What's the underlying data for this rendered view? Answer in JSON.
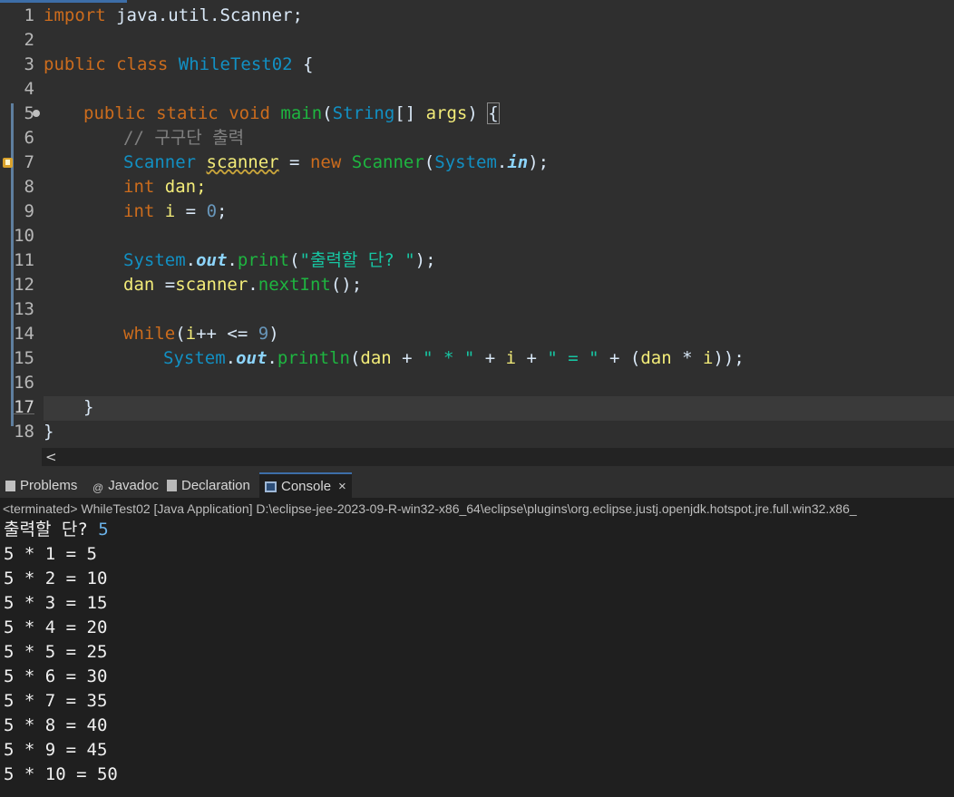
{
  "editor": {
    "line_numbers": [
      "1",
      "2",
      "3",
      "4",
      "5",
      "6",
      "7",
      "8",
      "9",
      "10",
      "11",
      "12",
      "13",
      "14",
      "15",
      "16",
      "17",
      "18"
    ],
    "code": {
      "l1_kw": "import",
      "l1_rest": " java.util.Scanner;",
      "l3_kw1": "public",
      "l3_kw2": "class",
      "l3_cls": "WhileTest02",
      "l3_brace": "{",
      "l5_kw1": "public",
      "l5_kw2": "static",
      "l5_kw3": "void",
      "l5_method": "main",
      "l5_type": "String",
      "l5_args": "args",
      "l6_comment": "// 구구단 출력",
      "l7_type": "Scanner",
      "l7_var": "scanner",
      "l7_kw": "new",
      "l7_cls": "Scanner",
      "l7_sys": "System",
      "l7_in": "in",
      "l8_kw": "int",
      "l8_var": "dan;",
      "l9_kw": "int",
      "l9_var": "i",
      "l9_num": "0",
      "l11_sys": "System",
      "l11_out": "out",
      "l11_method": "print",
      "l11_str": "\"출력할 단? \"",
      "l12_var": "dan",
      "l12_obj": "scanner",
      "l12_method": "nextInt",
      "l14_kw": "while",
      "l14_var": "i",
      "l14_num": "9",
      "l15_sys": "System",
      "l15_out": "out",
      "l15_method": "println",
      "l15_str1": "\" * \"",
      "l15_str2": "\" = \"",
      "l17_brace": "}",
      "l18_brace": "}"
    },
    "hscroll_arrow": "<"
  },
  "views": {
    "tabs": {
      "problems": "Problems",
      "javadoc": "Javadoc",
      "declaration": "Declaration",
      "console": "Console",
      "close": "×"
    },
    "console_status": "<terminated> WhileTest02 [Java Application] D:\\eclipse-jee-2023-09-R-win32-x86_64\\eclipse\\plugins\\org.eclipse.justj.openjdk.hotspot.jre.full.win32.x86_",
    "prompt": "출력할 단? ",
    "input": "5",
    "output": [
      "5 * 1 = 5",
      "5 * 2 = 10",
      "5 * 3 = 15",
      "5 * 4 = 20",
      "5 * 5 = 25",
      "5 * 6 = 30",
      "5 * 7 = 35",
      "5 * 8 = 40",
      "5 * 9 = 45",
      "5 * 10 = 50"
    ]
  }
}
